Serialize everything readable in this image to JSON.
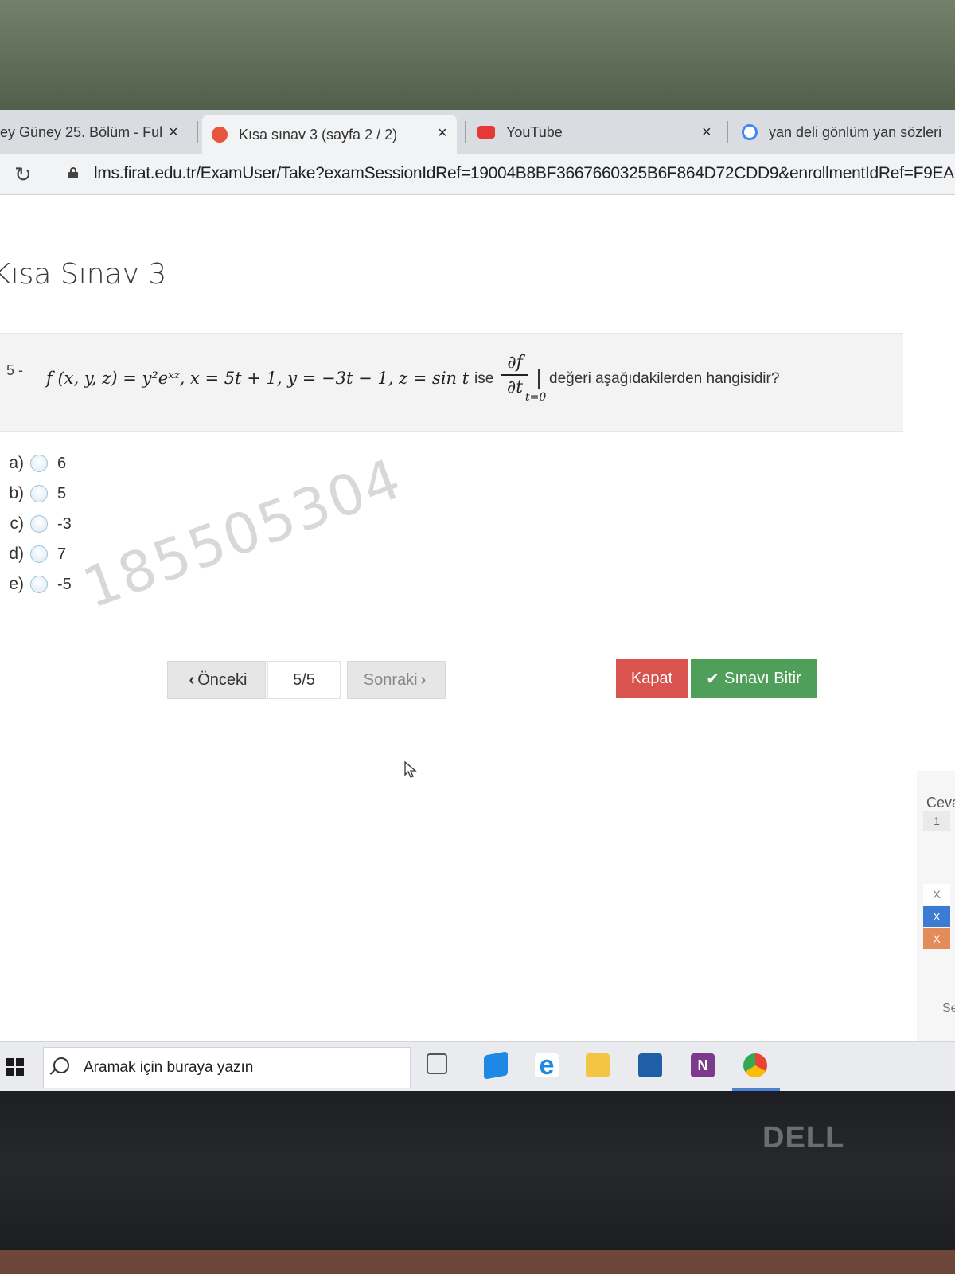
{
  "browser": {
    "tabs": [
      {
        "label": "ey Güney 25. Bölüm - Ful"
      },
      {
        "label": "Kısa sınav 3 (sayfa 2 / 2)"
      },
      {
        "label": "YouTube"
      },
      {
        "label": "yan deli gönlüm yan sözleri"
      }
    ],
    "close_symbol": "×",
    "url": "lms.firat.edu.tr/ExamUser/Take?examSessionIdRef=19004B8BF3667660325B6F864D72CDD9&enrollmentIdRef=F9EA"
  },
  "page": {
    "title": "Kısa Sınav 3",
    "watermark": "185505304"
  },
  "question": {
    "number": "5 -",
    "formula": "f (x, y, z) = y²eˣᶻ, x = 5t + 1, y = −3t − 1, z = sin t",
    "ise": "ise",
    "frac_num": "∂f",
    "frac_den": "∂t",
    "eval_sub": "t=0",
    "text": "değeri aşağıdakilerden hangisidir?"
  },
  "options": [
    {
      "letter": "a)",
      "value": "6"
    },
    {
      "letter": "b)",
      "value": "5"
    },
    {
      "letter": "c)",
      "value": "-3"
    },
    {
      "letter": "d)",
      "value": "7"
    },
    {
      "letter": "e)",
      "value": "-5"
    }
  ],
  "nav": {
    "prev_label": "Önceki",
    "page_indicator": "5/5",
    "next_label": "Sonraki",
    "close_label": "Kapat",
    "finish_label": "Sınavı Bitir"
  },
  "side_panel": {
    "title": "Ceva",
    "cell_1": "1",
    "cell_x1": "X",
    "cell_x2": "X",
    "cell_x3": "X",
    "bottom_text": "Se"
  },
  "taskbar": {
    "search_placeholder": "Aramak için buraya yazın"
  },
  "bezel": {
    "brand": "DELL"
  },
  "colors": {
    "close_button": "#d9534f",
    "finish_button": "#4f9f5b"
  }
}
